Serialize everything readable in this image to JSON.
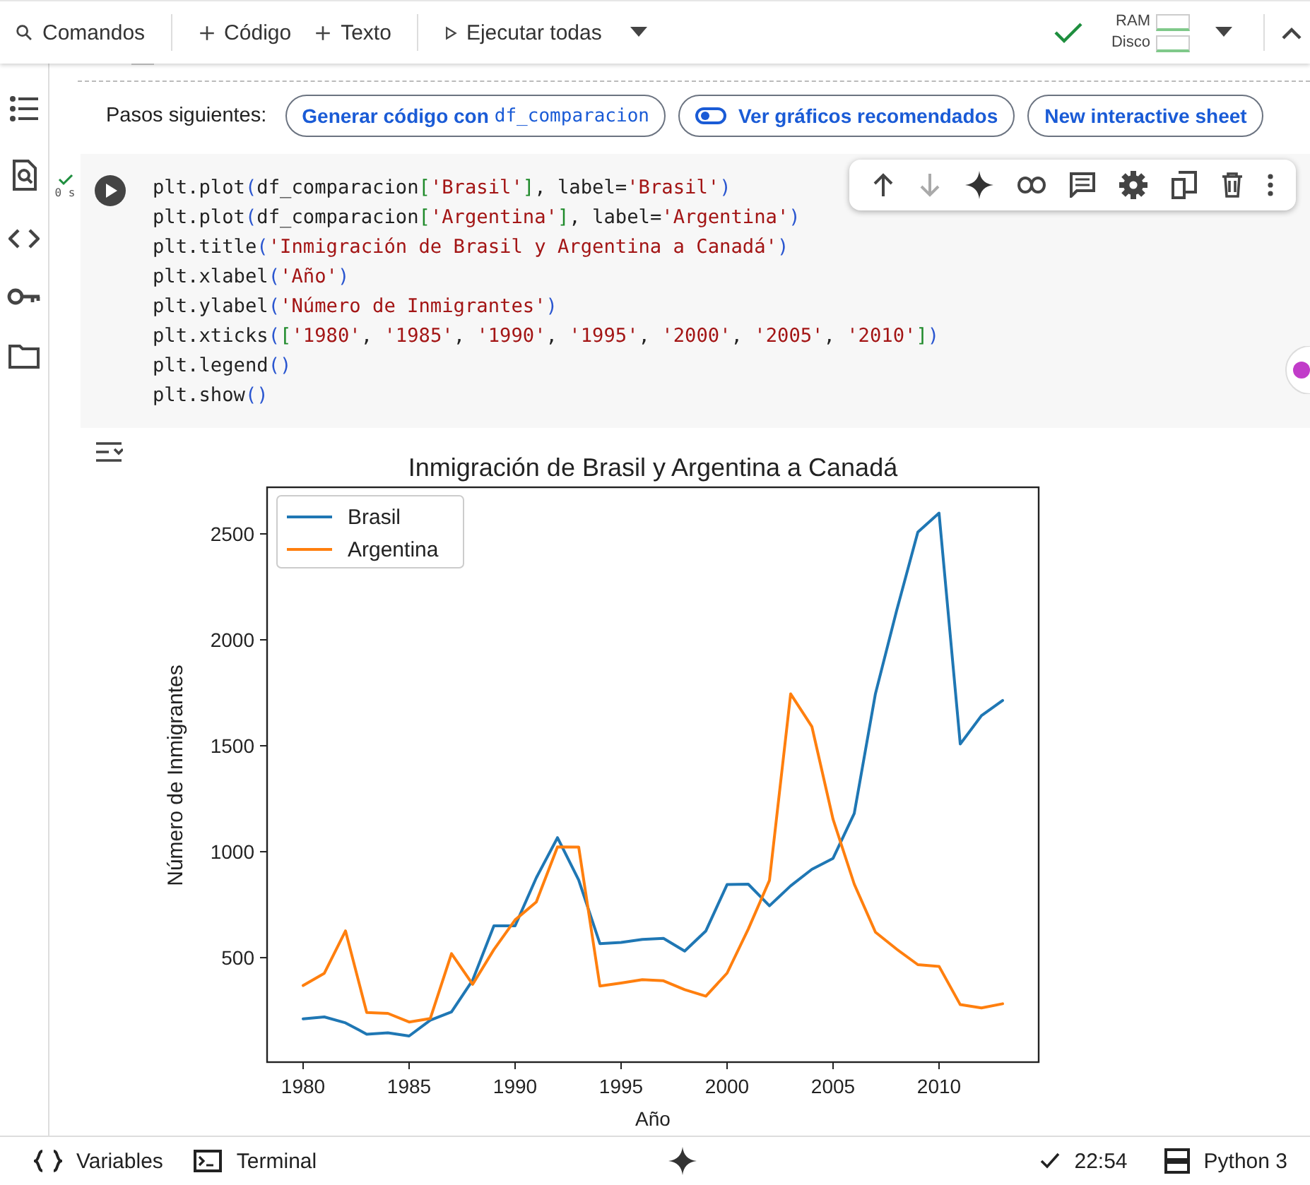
{
  "toolbar": {
    "items": [
      {
        "kind": "search",
        "label": "Comandos"
      },
      {
        "kind": "add",
        "label": "Código"
      },
      {
        "kind": "add",
        "label": "Texto"
      },
      {
        "kind": "run",
        "label": "Ejecutar todas"
      }
    ],
    "resources": [
      {
        "label": "RAM"
      },
      {
        "label": "Disco"
      }
    ]
  },
  "next_steps": {
    "label": "Pasos siguientes:",
    "buttons": [
      {
        "kind": "code",
        "text": "Generar código con",
        "code": "df_comparacion"
      },
      {
        "kind": "toggle",
        "text": "Ver gráficos recomendados"
      },
      {
        "kind": "plain",
        "text": "New interactive sheet"
      }
    ]
  },
  "cell": {
    "status": "0 s",
    "code": [
      [
        {
          "t": "plt.plot",
          "kind": "plain"
        },
        {
          "t": "(",
          "kind": "paren"
        },
        {
          "t": "df_comparacion",
          "kind": "plain"
        },
        {
          "t": "[",
          "kind": "bracket"
        },
        {
          "t": "'Brasil'",
          "kind": "string"
        },
        {
          "t": "]",
          "kind": "bracket"
        },
        {
          "t": ", label=",
          "kind": "plain"
        },
        {
          "t": "'Brasil'",
          "kind": "string"
        },
        {
          "t": ")",
          "kind": "paren"
        }
      ],
      [
        {
          "t": "plt.plot",
          "kind": "plain"
        },
        {
          "t": "(",
          "kind": "paren"
        },
        {
          "t": "df_comparacion",
          "kind": "plain"
        },
        {
          "t": "[",
          "kind": "bracket"
        },
        {
          "t": "'Argentina'",
          "kind": "string"
        },
        {
          "t": "]",
          "kind": "bracket"
        },
        {
          "t": ", label=",
          "kind": "plain"
        },
        {
          "t": "'Argentina'",
          "kind": "string"
        },
        {
          "t": ")",
          "kind": "paren"
        }
      ],
      [
        {
          "t": "plt.title",
          "kind": "plain"
        },
        {
          "t": "(",
          "kind": "paren"
        },
        {
          "t": "'Inmigración de Brasil y Argentina a Canadá'",
          "kind": "string"
        },
        {
          "t": ")",
          "kind": "paren"
        }
      ],
      [
        {
          "t": "plt.xlabel",
          "kind": "plain"
        },
        {
          "t": "(",
          "kind": "paren"
        },
        {
          "t": "'Año'",
          "kind": "string"
        },
        {
          "t": ")",
          "kind": "paren"
        }
      ],
      [
        {
          "t": "plt.ylabel",
          "kind": "plain"
        },
        {
          "t": "(",
          "kind": "paren"
        },
        {
          "t": "'Número de Inmigrantes'",
          "kind": "string"
        },
        {
          "t": ")",
          "kind": "paren"
        }
      ],
      [
        {
          "t": "plt.xticks",
          "kind": "plain"
        },
        {
          "t": "(",
          "kind": "paren"
        },
        {
          "t": "[",
          "kind": "bracket"
        },
        {
          "t": "'1980'",
          "kind": "string"
        },
        {
          "t": ", ",
          "kind": "plain"
        },
        {
          "t": "'1985'",
          "kind": "string"
        },
        {
          "t": ", ",
          "kind": "plain"
        },
        {
          "t": "'1990'",
          "kind": "string"
        },
        {
          "t": ", ",
          "kind": "plain"
        },
        {
          "t": "'1995'",
          "kind": "string"
        },
        {
          "t": ", ",
          "kind": "plain"
        },
        {
          "t": "'2000'",
          "kind": "string"
        },
        {
          "t": ", ",
          "kind": "plain"
        },
        {
          "t": "'2005'",
          "kind": "string"
        },
        {
          "t": ", ",
          "kind": "plain"
        },
        {
          "t": "'2010'",
          "kind": "string"
        },
        {
          "t": "]",
          "kind": "bracket"
        },
        {
          "t": ")",
          "kind": "paren"
        }
      ],
      [
        {
          "t": "plt.legend",
          "kind": "plain"
        },
        {
          "t": "()",
          "kind": "paren"
        }
      ],
      [
        {
          "t": "plt.show",
          "kind": "plain"
        },
        {
          "t": "()",
          "kind": "paren"
        }
      ]
    ],
    "chart_data": {
      "type": "line",
      "title": "Inmigración de Brasil y Argentina a Canadá",
      "xlabel": "Año",
      "ylabel": "Número de Inmigrantes",
      "x": [
        1980,
        1981,
        1982,
        1983,
        1984,
        1985,
        1986,
        1987,
        1988,
        1989,
        1990,
        1991,
        1992,
        1993,
        1994,
        1995,
        1996,
        1997,
        1998,
        1999,
        2000,
        2001,
        2002,
        2003,
        2004,
        2005,
        2006,
        2007,
        2008,
        2009,
        2010,
        2011,
        2012,
        2013
      ],
      "series": [
        {
          "name": "Brasil",
          "color": "#1f77b4",
          "values": [
            211,
            220,
            192,
            139,
            145,
            130,
            205,
            244,
            394,
            650,
            650,
            877,
            1066,
            866,
            566,
            572,
            586,
            591,
            531,
            626,
            845,
            847,
            745,
            839,
            917,
            969,
            1181,
            1746,
            2138,
            2509,
            2598,
            1508,
            1642,
            1714
          ]
        },
        {
          "name": "Argentina",
          "color": "#ff7f0e",
          "values": [
            368,
            426,
            626,
            241,
            237,
            196,
            213,
            519,
            374,
            538,
            678,
            763,
            1023,
            1022,
            366,
            380,
            396,
            391,
            349,
            318,
            427,
            635,
            865,
            1745,
            1591,
            1153,
            847,
            620,
            540,
            467,
            459,
            278,
            263,
            282
          ]
        }
      ],
      "xlim": [
        1978.3,
        2014.7
      ],
      "ylim": [
        7,
        2720
      ],
      "xticks": [
        1980,
        1985,
        1990,
        1995,
        2000,
        2005,
        2010
      ],
      "yticks": [
        500,
        1000,
        1500,
        2000,
        2500
      ],
      "legend": "upper left"
    }
  },
  "status_bar": {
    "left": [
      {
        "kind": "braces",
        "label": "Variables"
      },
      {
        "kind": "terminal",
        "label": "Terminal"
      }
    ],
    "time": "22:54",
    "runtime": "Python 3"
  }
}
